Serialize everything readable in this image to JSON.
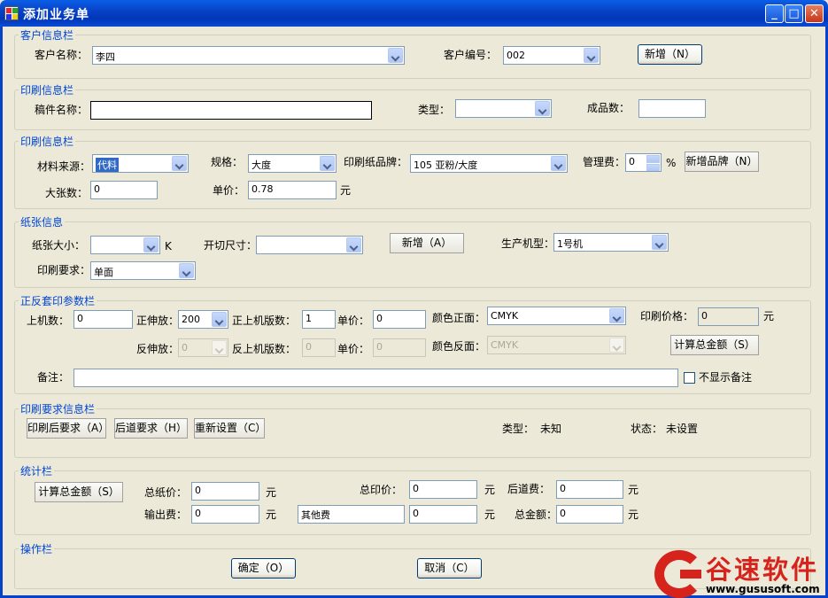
{
  "window": {
    "title": "添加业务单",
    "minimize": "_",
    "maximize": "□",
    "close": "✕"
  },
  "customer": {
    "legend": "客户信息栏",
    "name_label": "客户名称：",
    "name_value": "李四",
    "code_label": "客户编号：",
    "code_value": "002",
    "add_button": "新增（N）"
  },
  "print_info1": {
    "legend": "印刷信息栏",
    "manuscript_label": "稿件名称：",
    "manuscript_value": "",
    "type_label": "类型：",
    "type_value": "",
    "finished_label": "成品数：",
    "finished_value": ""
  },
  "print_info2": {
    "legend": "印刷信息栏",
    "source_label": "材料来源：",
    "source_value": "代料",
    "spec_label": "规格：",
    "spec_value": "大度",
    "brand_label": "印刷纸品牌：",
    "brand_value": "105 亚粉/大度",
    "fee_label": "管理费：",
    "fee_value": "0",
    "fee_unit": "%",
    "add_brand_button": "新增品牌（N）",
    "sheets_label": "大张数：",
    "sheets_value": "0",
    "price_label": "单价：",
    "price_value": "0.78",
    "price_unit": "元"
  },
  "paper": {
    "legend": "纸张信息",
    "size_label": "纸张大小：",
    "size_value": "",
    "size_unit": "K",
    "cut_label": "开切尺寸：",
    "cut_value": "",
    "add_button": "新增（A）",
    "machine_label": "生产机型：",
    "machine_value": "1号机",
    "req_label": "印刷要求：",
    "req_value": "单面"
  },
  "double_side": {
    "legend": "正反套印参数栏",
    "machines_label": "上机数：",
    "machines_value": "0",
    "front_stretch_label": "正伸放：",
    "front_stretch_value": "200",
    "front_plates_label": "正上机版数：",
    "front_plates_value": "1",
    "front_price_label": "单价：",
    "front_price_value": "0",
    "front_color_label": "颜色正面：",
    "front_color_value": "CMYK",
    "print_price_label": "印刷价格：",
    "print_price_value": "0",
    "print_price_unit": "元",
    "back_stretch_label": "反伸放：",
    "back_stretch_value": "0",
    "back_plates_label": "反上机版数：",
    "back_plates_value": "0",
    "back_price_label": "单价：",
    "back_price_value": "0",
    "back_color_label": "颜色反面：",
    "back_color_value": "CMYK",
    "calc_button": "计算总金额（S）",
    "remark_label": "备注：",
    "remark_value": "",
    "hide_remark_label": "不显示备注"
  },
  "requirements": {
    "legend": "印刷要求信息栏",
    "after_print_button": "印刷后要求（A）",
    "post_button": "后道要求（H）",
    "reset_button": "重新设置（C）",
    "type_label": "类型：",
    "type_value": "未知",
    "status_label": "状态：",
    "status_value": "未设置"
  },
  "stats": {
    "legend": "统计栏",
    "calc_button": "计算总金额（S）",
    "paper_total_label": "总纸价：",
    "paper_total_value": "0",
    "paper_total_unit": "元",
    "print_total_label": "总印价：",
    "print_total_value": "0",
    "print_total_unit": "元",
    "post_fee_label": "后道费：",
    "post_fee_value": "0",
    "post_fee_unit": "元",
    "output_fee_label": "输出费：",
    "output_fee_value": "0",
    "output_fee_unit": "元",
    "other_fee_name": "其他费",
    "other_fee_value": "0",
    "other_fee_unit": "元",
    "total_label": "总金额：",
    "total_value": "0",
    "total_unit": "元"
  },
  "actions": {
    "legend": "操作栏",
    "ok_button": "确定（O）",
    "cancel_button": "取消（C）"
  },
  "watermark": {
    "name": "谷速软件",
    "url": "www.gususoft.com"
  }
}
